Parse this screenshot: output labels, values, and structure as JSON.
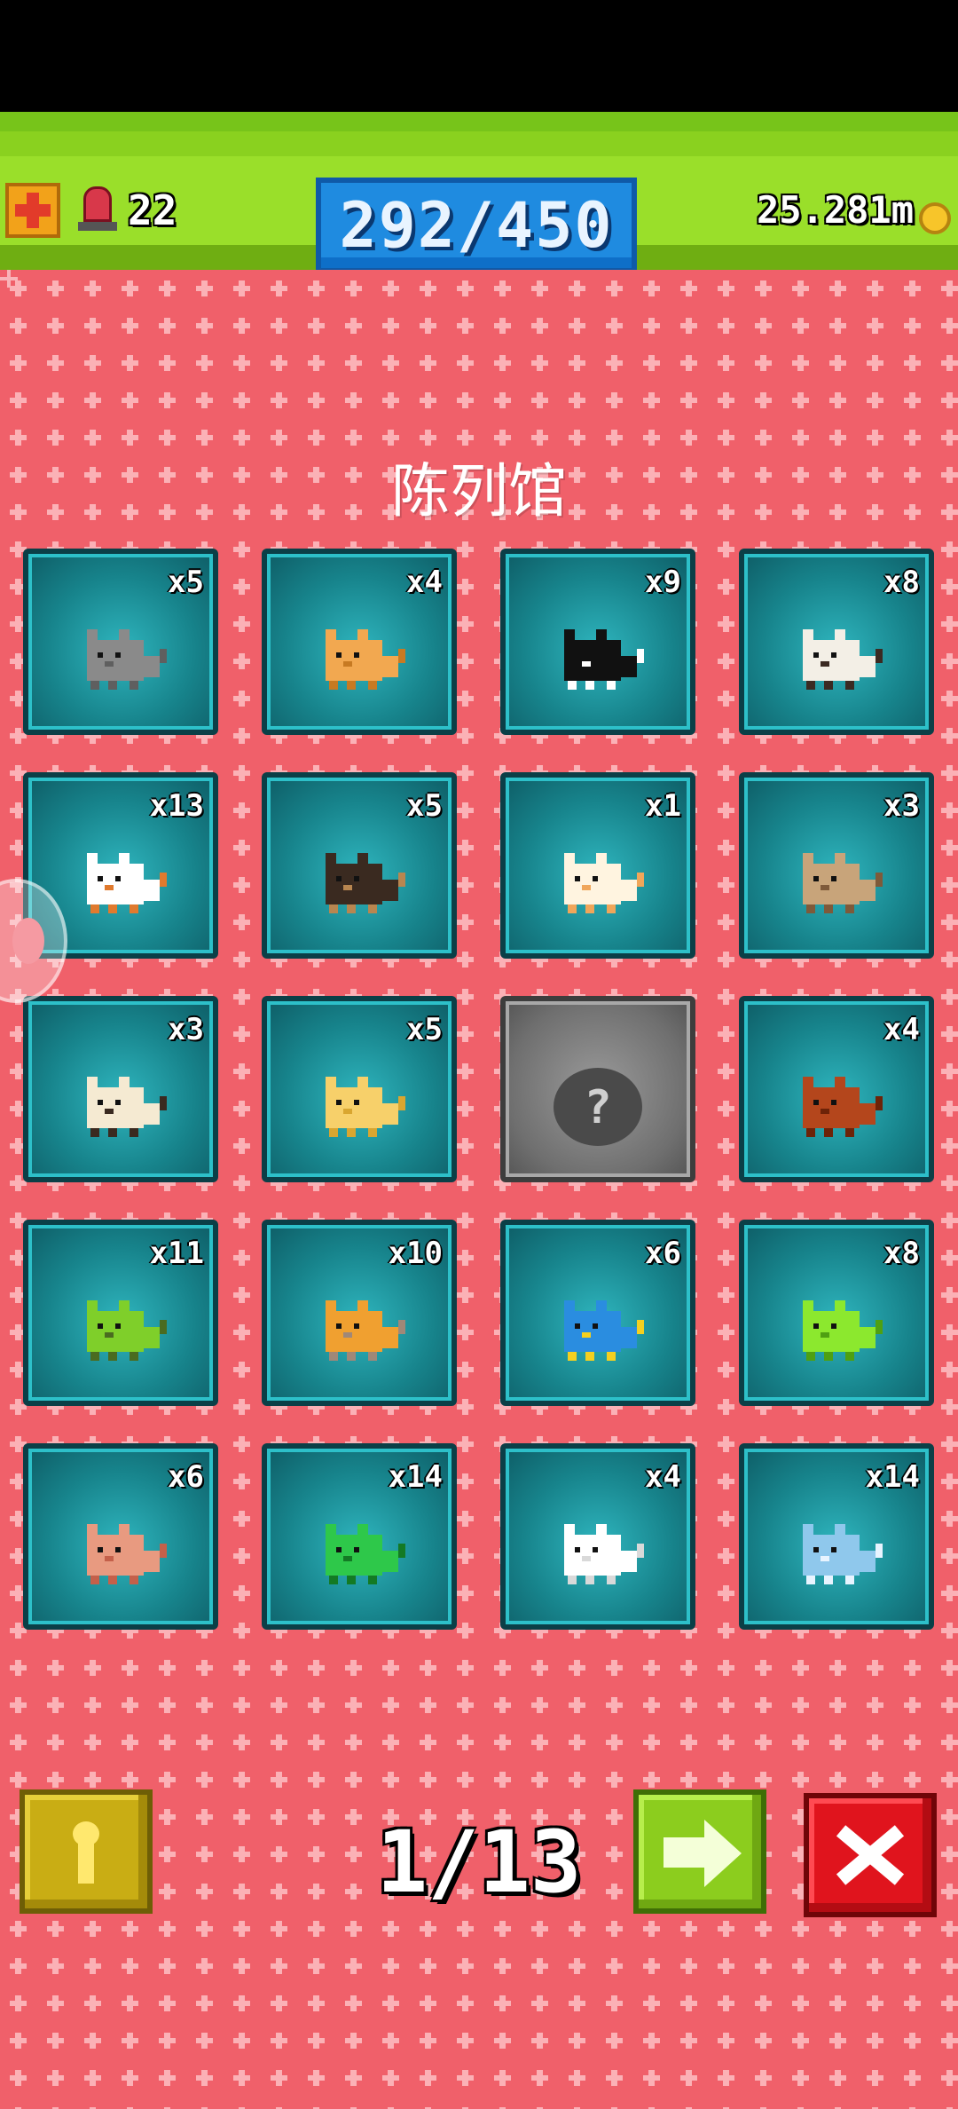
{
  "hud": {
    "alarm_count": "22",
    "progress": "292/450",
    "coins": "25.281m"
  },
  "title": "陈列馆",
  "pets": [
    {
      "count": "x5",
      "icon": "gray-cat-icon",
      "colors": [
        "#8a8a8a",
        "#5f5f5f"
      ]
    },
    {
      "count": "x4",
      "icon": "orange-cat-icon",
      "colors": [
        "#f2a850",
        "#c77a22"
      ]
    },
    {
      "count": "x9",
      "icon": "tuxedo-cat-icon",
      "colors": [
        "#111111",
        "#ffffff"
      ]
    },
    {
      "count": "x8",
      "icon": "siamese-cat-icon",
      "colors": [
        "#f3efe6",
        "#3b2a22"
      ]
    },
    {
      "count": "x13",
      "icon": "calico-cat-icon",
      "colors": [
        "#ffffff",
        "#e07a2e"
      ]
    },
    {
      "count": "x5",
      "icon": "cat-in-box-icon",
      "colors": [
        "#3a2a20",
        "#b88650"
      ]
    },
    {
      "count": "x1",
      "icon": "orange-white-cat-icon",
      "colors": [
        "#fff4e0",
        "#f0a65a"
      ]
    },
    {
      "count": "x3",
      "icon": "tabby-cat-icon",
      "colors": [
        "#c8a47a",
        "#7e5a3a"
      ]
    },
    {
      "count": "x3",
      "icon": "pug-icon",
      "colors": [
        "#f5ead2",
        "#3a2a20"
      ]
    },
    {
      "count": "x5",
      "icon": "yellow-cat-icon",
      "colors": [
        "#f7d06a",
        "#d9a630"
      ]
    },
    {
      "count": "",
      "icon": "locked-question-icon",
      "colors": [
        "#4a4a4a",
        "#cfcfcf"
      ],
      "locked": true
    },
    {
      "count": "x4",
      "icon": "brown-dog-icon",
      "colors": [
        "#b4461c",
        "#6d2308"
      ]
    },
    {
      "count": "x11",
      "icon": "turtle-icon",
      "colors": [
        "#7fcf2a",
        "#4a6b20"
      ]
    },
    {
      "count": "x10",
      "icon": "snail-icon",
      "colors": [
        "#f0a030",
        "#a08878"
      ]
    },
    {
      "count": "x6",
      "icon": "parrot-icon",
      "colors": [
        "#2a8de0",
        "#f4d020"
      ]
    },
    {
      "count": "x8",
      "icon": "chameleon-icon",
      "colors": [
        "#8ce82e",
        "#4ea012"
      ]
    },
    {
      "count": "x6",
      "icon": "octopus-icon",
      "colors": [
        "#e89a80",
        "#c4604a"
      ]
    },
    {
      "count": "x14",
      "icon": "snake-icon",
      "colors": [
        "#2ec84a",
        "#137a24"
      ]
    },
    {
      "count": "x4",
      "icon": "white-cat-icon",
      "colors": [
        "#ffffff",
        "#d9d9d9"
      ]
    },
    {
      "count": "x14",
      "icon": "narwhal-icon",
      "colors": [
        "#8fc8ec",
        "#e8f4ff"
      ]
    }
  ],
  "pagination": {
    "page": "1/13"
  },
  "colors": {
    "board": "#f0606a",
    "hud": "#8ad11f",
    "progress": "#1f8be0"
  }
}
